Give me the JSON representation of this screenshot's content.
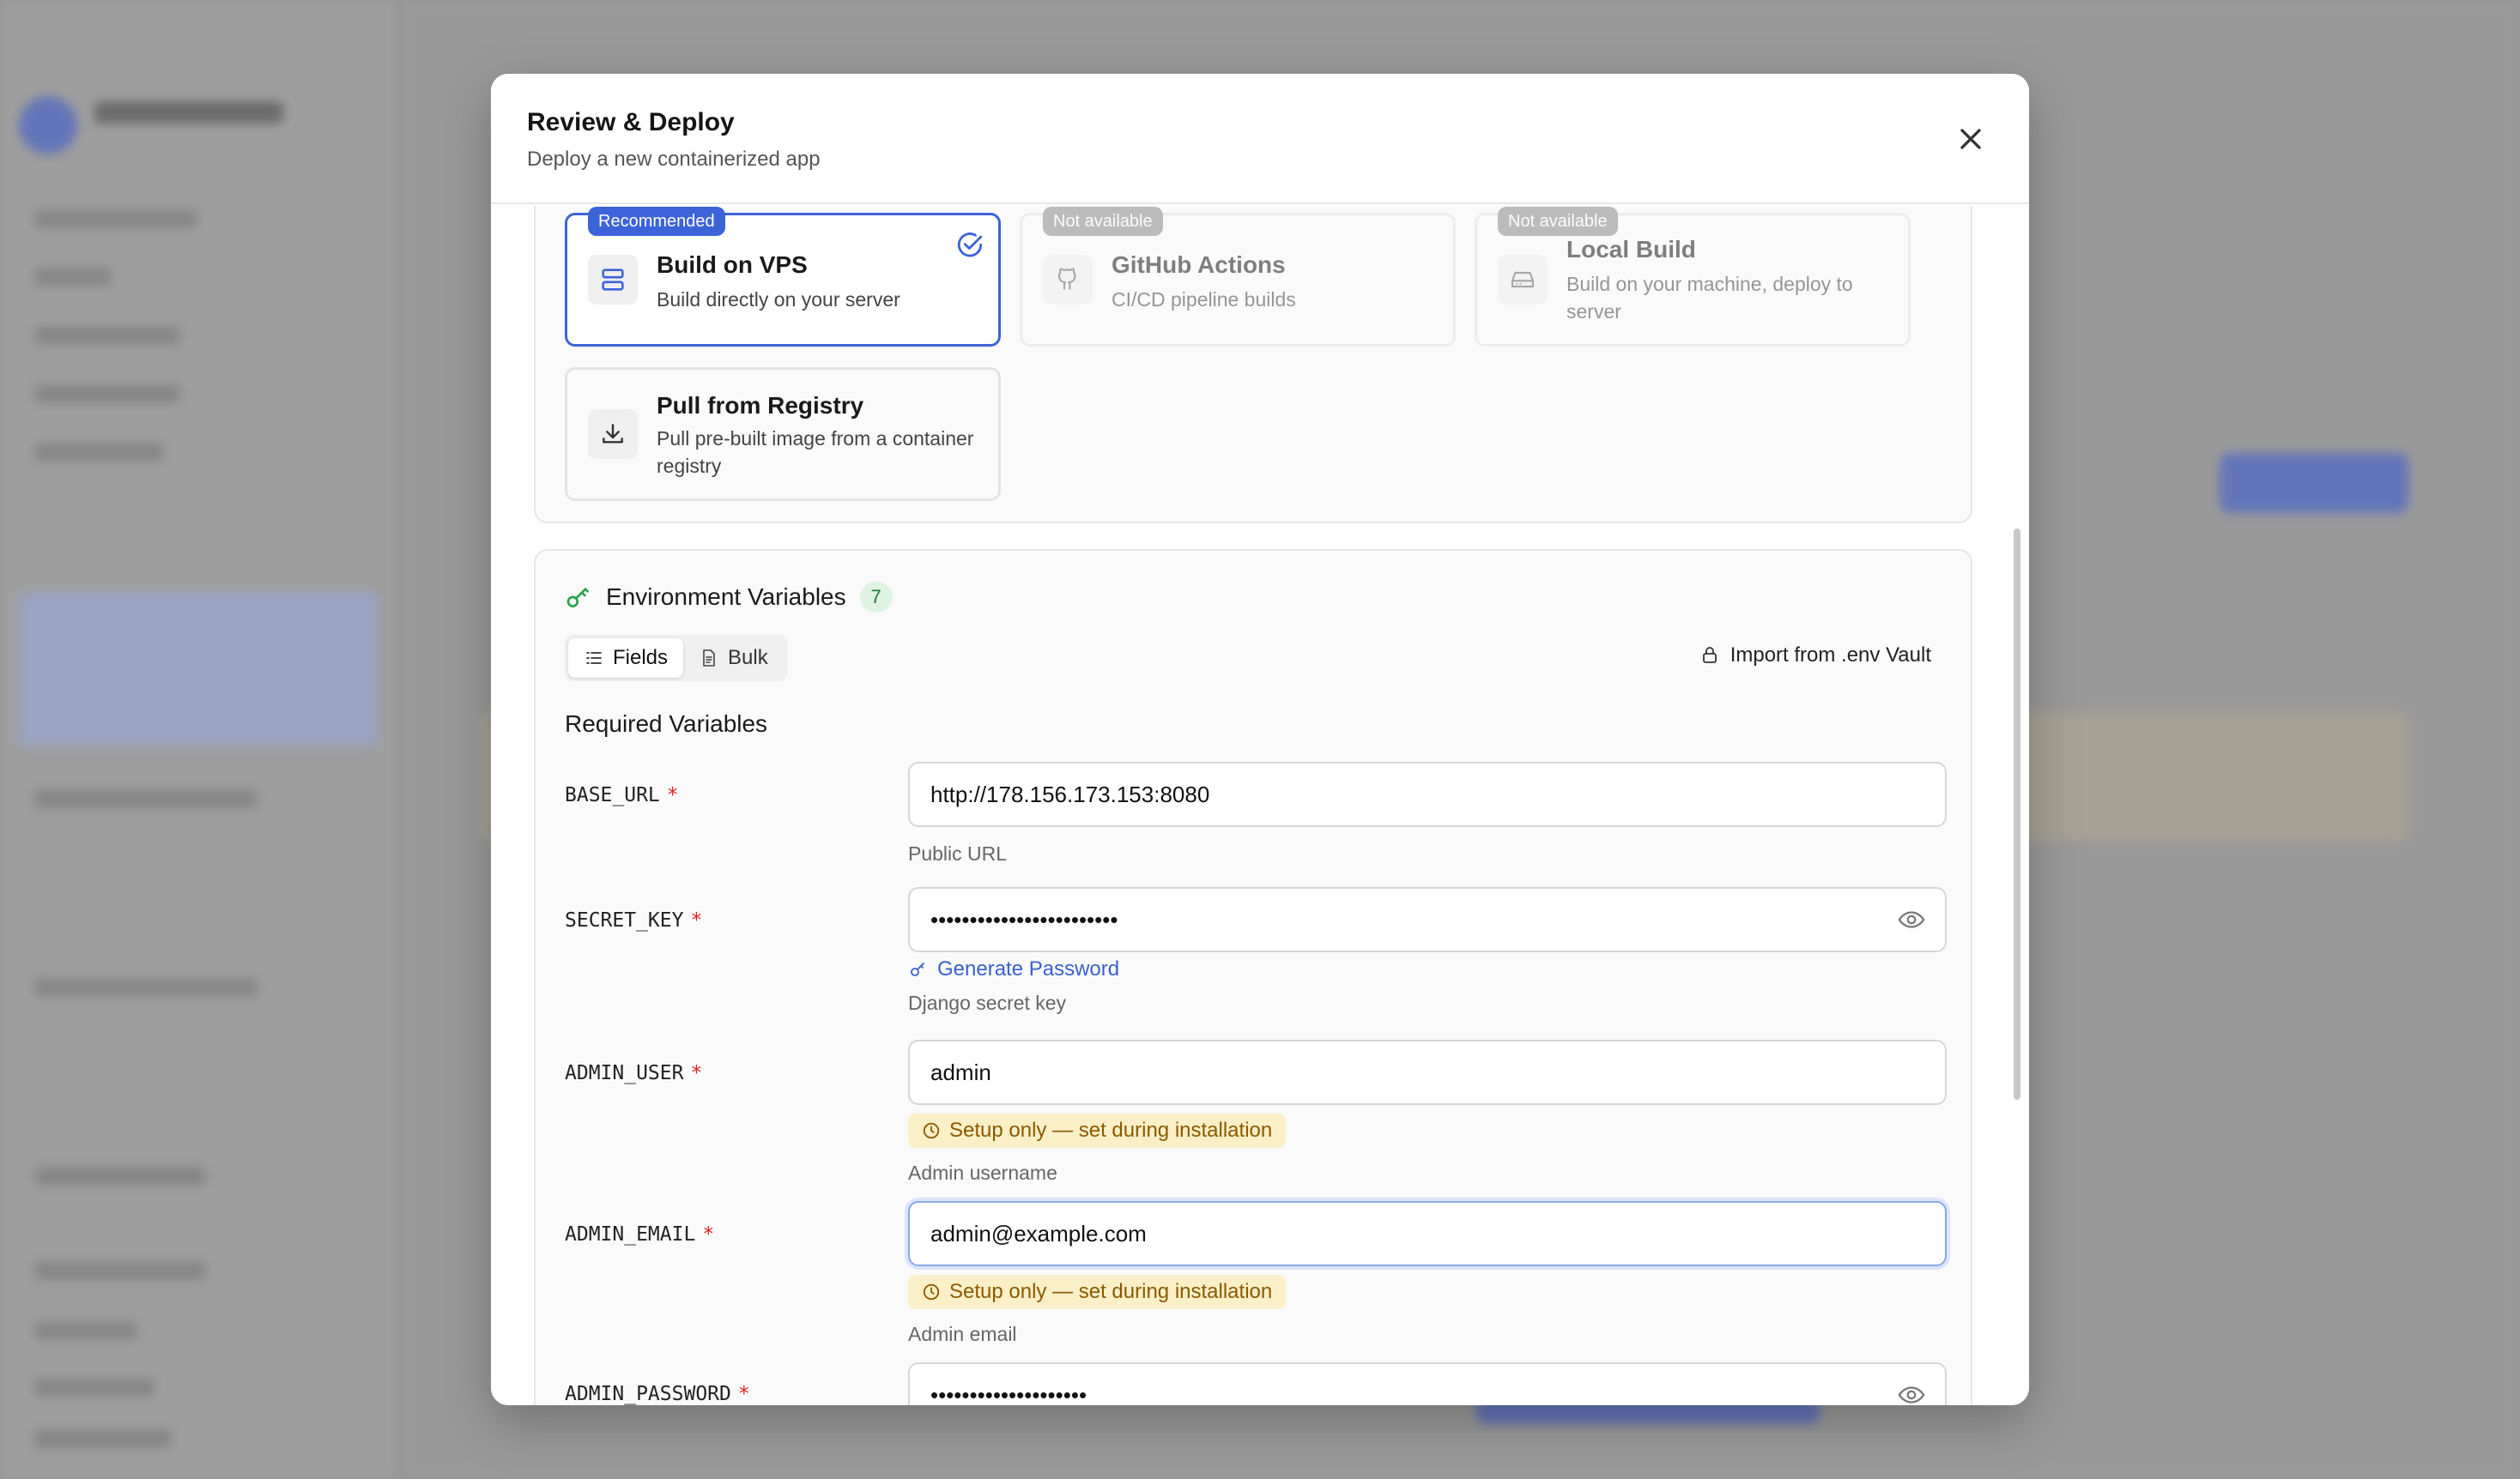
{
  "modal": {
    "title": "Review & Deploy",
    "subtitle": "Deploy a new containerized app"
  },
  "build_methods": [
    {
      "badge": "Recommended",
      "title": "Build on VPS",
      "desc": "Build directly on your server",
      "state": "selected"
    },
    {
      "badge": "Not available",
      "title": "GitHub Actions",
      "desc": "CI/CD pipeline builds",
      "state": "disabled"
    },
    {
      "badge": "Not available",
      "title": "Local Build",
      "desc": "Build on your machine, deploy to server",
      "state": "disabled"
    },
    {
      "badge": "",
      "title": "Pull from Registry",
      "desc": "Pull pre-built image from a container registry",
      "state": "enabled"
    }
  ],
  "env": {
    "title": "Environment Variables",
    "count": "7",
    "tabs": [
      "Fields",
      "Bulk"
    ],
    "import_label": "Import from .env Vault",
    "required_heading": "Required Variables",
    "generate_label": "Generate Password",
    "setup_note": "Setup only — set during installation",
    "vars": [
      {
        "key": "BASE_URL",
        "value": "http://178.156.173.153:8080",
        "hint": "Public URL"
      },
      {
        "key": "SECRET_KEY",
        "value": "••••••••••••••••••••••••",
        "hint": "Django secret key"
      },
      {
        "key": "ADMIN_USER",
        "value": "admin",
        "hint": "Admin username"
      },
      {
        "key": "ADMIN_EMAIL",
        "value": "admin@example.com",
        "hint": "Admin email"
      },
      {
        "key": "ADMIN_PASSWORD",
        "value": "••••••••••••••••••••",
        "hint": ""
      }
    ]
  },
  "colors": {
    "accent": "#3d63d9",
    "required": "#dd2222",
    "warn_bg": "#fbefc7",
    "success": "#2aa24a"
  }
}
